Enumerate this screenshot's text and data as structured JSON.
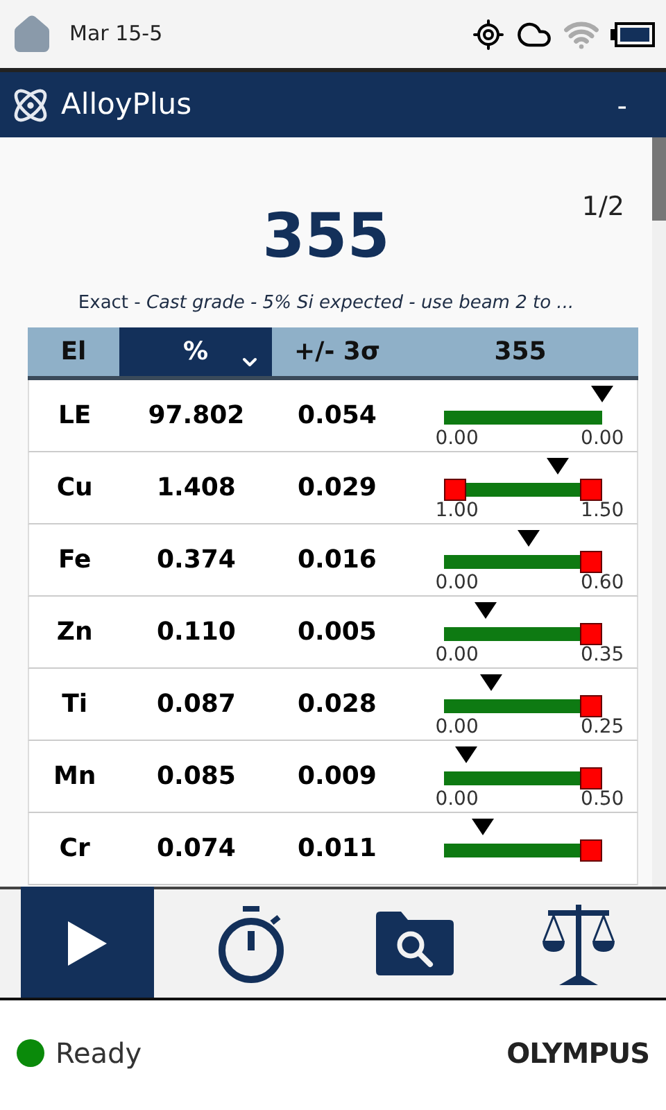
{
  "status_bar": {
    "date": "Mar 15-5"
  },
  "app_bar": {
    "title": "AlloyPlus",
    "action": "-"
  },
  "result": {
    "grade": "355",
    "page": "1/2",
    "match": "Exact - *Cast grade - 5% Si expected - use beam 2 to ...*"
  },
  "table": {
    "columns": [
      {
        "label": "El",
        "selected": false
      },
      {
        "label": "%",
        "selected": true
      },
      {
        "label": "+/- 3σ",
        "selected": false
      },
      {
        "label": "355",
        "selected": false
      }
    ],
    "rows": [
      {
        "element": "LE",
        "percent": "97.802",
        "sigma": "0.054",
        "level": 1.0,
        "min": "0.00",
        "max": "0.00",
        "low_flag": false,
        "high_flag": false
      },
      {
        "element": "Cu",
        "percent": "1.408",
        "sigma": "0.029",
        "level": 0.72,
        "min": "1.00",
        "max": "1.50",
        "low_flag": true,
        "high_flag": true
      },
      {
        "element": "Fe",
        "percent": "0.374",
        "sigma": "0.016",
        "level": 0.54,
        "min": "0.00",
        "max": "0.60",
        "low_flag": false,
        "high_flag": true
      },
      {
        "element": "Zn",
        "percent": "0.110",
        "sigma": "0.005",
        "level": 0.27,
        "min": "0.00",
        "max": "0.35",
        "low_flag": false,
        "high_flag": true
      },
      {
        "element": "Ti",
        "percent": "0.087",
        "sigma": "0.028",
        "level": 0.3,
        "min": "0.00",
        "max": "0.25",
        "low_flag": false,
        "high_flag": true
      },
      {
        "element": "Mn",
        "percent": "0.085",
        "sigma": "0.009",
        "level": 0.14,
        "min": "0.00",
        "max": "0.50",
        "low_flag": false,
        "high_flag": true
      },
      {
        "element": "Cr",
        "percent": "0.074",
        "sigma": "0.011",
        "level": 0.25,
        "low_flag": false,
        "high_flag": true
      }
    ]
  },
  "toolbar": [
    {
      "kind": "play",
      "selected": true
    },
    {
      "kind": "timer",
      "selected": false
    },
    {
      "kind": "folder-search",
      "selected": false
    },
    {
      "kind": "scale",
      "selected": false
    }
  ],
  "footer": {
    "status": "Ready",
    "ready": true,
    "brand": "OLYMPUS"
  }
}
